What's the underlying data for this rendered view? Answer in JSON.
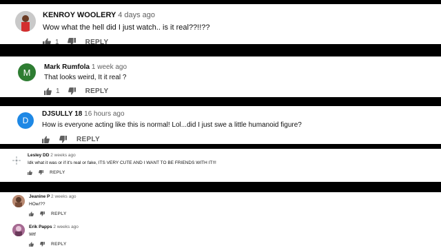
{
  "colors": {
    "letterbox": "#000000",
    "panel": "#ffffff",
    "avatar_m": "#2e7d32",
    "avatar_d": "#1e88e5",
    "avatar_k": "#d32f2f"
  },
  "icons": {
    "like": "thumbs-up-icon",
    "dislike": "thumbs-down-icon"
  },
  "comments": [
    {
      "author": "KENROY WOOLERY",
      "time": "4 days ago",
      "text": "Wow what the hell did I just watch.. is it real??!!??",
      "likes": "1",
      "reply": "REPLY",
      "avatar_letter": ""
    },
    {
      "author": "Mark Rumfola",
      "time": "1 week ago",
      "text": "That looks weird,  It it real ?",
      "likes": "1",
      "reply": "REPLY",
      "avatar_letter": "M"
    },
    {
      "author": "DJSULLY 18",
      "time": "16 hours ago",
      "text": "How is everyone acting like this is normal! Lol...did I just swe a little humanoid figure?",
      "likes": "",
      "reply": "REPLY",
      "avatar_letter": "D"
    },
    {
      "author": "Lesley DD",
      "time": "2 weeks ago",
      "text": "Idk what it was or if it's real or fake, ITS VERY CUTE AND I WANT TO BE FRIENDS WITH IT!!!",
      "likes": "",
      "reply": "REPLY",
      "avatar_letter": ""
    },
    {
      "author": "Jeanine P",
      "time": "2 weeks ago",
      "text": "HOw!??",
      "likes": "",
      "reply": "REPLY",
      "avatar_letter": ""
    },
    {
      "author": "Erik Papps",
      "time": "2 weeks ago",
      "text": "Wtf",
      "likes": "",
      "reply": "REPLY",
      "avatar_letter": ""
    }
  ]
}
